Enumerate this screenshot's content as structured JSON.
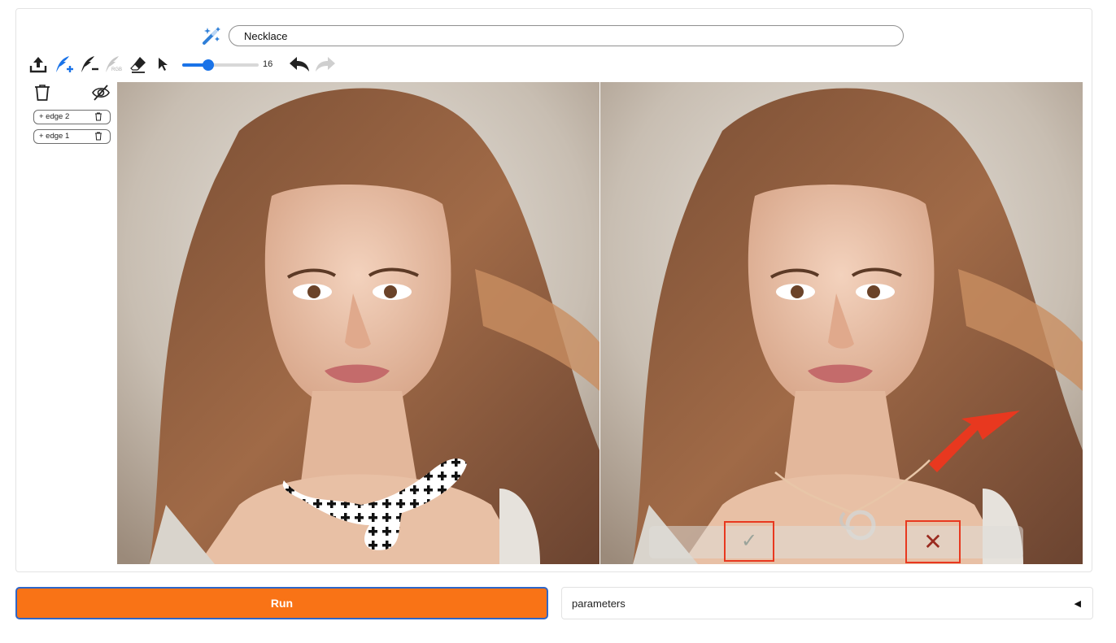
{
  "prompt": {
    "value": "Necklace"
  },
  "toolbar": {
    "tools": [
      "upload-icon",
      "brush-add-icon",
      "brush-subtract-icon",
      "brush-rgb-icon",
      "eraser-icon",
      "pointer-icon"
    ],
    "rgb_tag": "RGB",
    "brush_size": "16",
    "brush_size_fraction": 0.34
  },
  "layers": [
    {
      "label": "+ edge 2"
    },
    {
      "label": "+ edge 1"
    }
  ],
  "result_overlay": {
    "accept_label": "✓",
    "reject_label": "✕"
  },
  "run": {
    "label": "Run"
  },
  "parameters": {
    "label": "parameters",
    "caret": "◀"
  },
  "colors": {
    "accent": "#1a73e8",
    "run": "#f97316",
    "highlight": "#e8381f"
  }
}
